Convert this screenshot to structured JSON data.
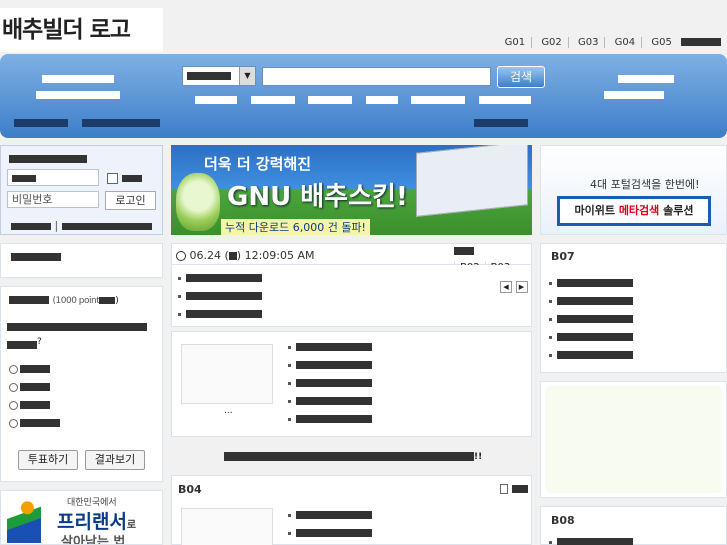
{
  "logo": {
    "text": "배추빌더 로고"
  },
  "top_nav": [
    "G01",
    "G02",
    "G03",
    "G04",
    "G05"
  ],
  "search": {
    "button_label": "검색"
  },
  "login": {
    "password_placeholder": "비밀번호",
    "login_button": "로고인"
  },
  "poll": {
    "point_text": "(1000 point",
    "vote_button": "투표하기",
    "result_button": "결과보기"
  },
  "main_banner": {
    "line1": "더욱 더 강력해진",
    "line2": "GNU 배추스킨!",
    "line3": "누적 다운로드 6,000 건 돌파!"
  },
  "ad_banner": {
    "line1": "4대 포털검색을 한번에!",
    "line2_prefix": "마이위트 ",
    "line2_highlight": "메타검색",
    "line2_suffix": " 솔루션"
  },
  "datetime": {
    "date": "06.24",
    "time": "12:09:05 AM"
  },
  "tabs": [
    "B02",
    "B03"
  ],
  "boards": {
    "b04": "B04",
    "b07": "B07",
    "b08": "B08"
  },
  "gallery_caption": "...",
  "bottom_banner": {
    "small": "대한민국에서",
    "big": "프리랜서",
    "suffix": "로",
    "tail": "살아남는 법"
  },
  "colors": {
    "banner_top": "#7fb0e4",
    "banner_bottom": "#3d7ec9",
    "highlight_red": "#e0001a",
    "ad_border": "#1a5bb8"
  }
}
